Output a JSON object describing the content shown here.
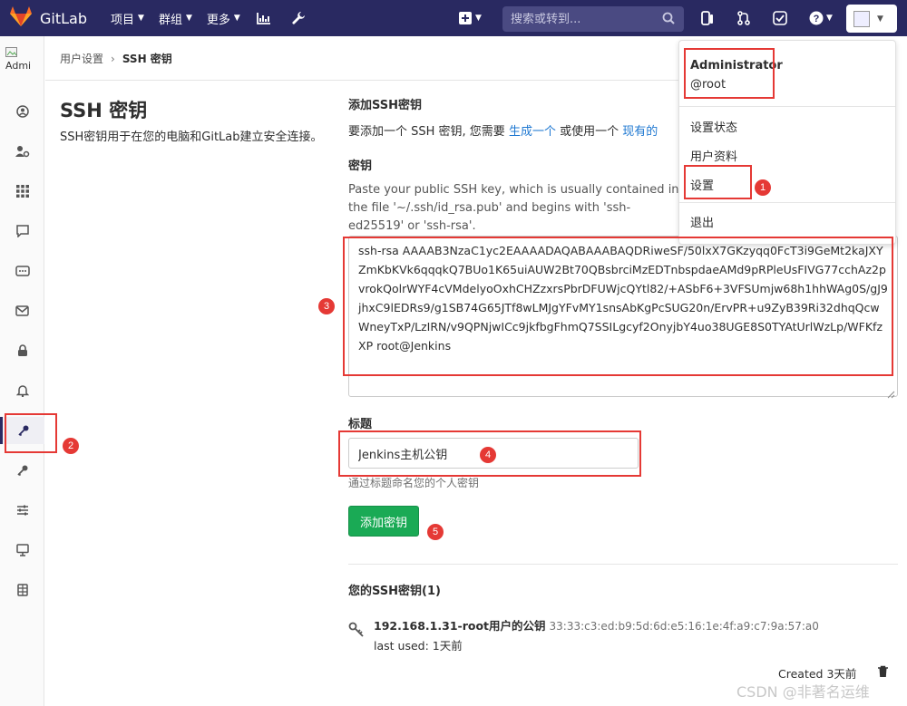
{
  "nav": {
    "brand": "GitLab",
    "menu": [
      {
        "label": "项目"
      },
      {
        "label": "群组"
      },
      {
        "label": "更多"
      }
    ],
    "search_placeholder": "搜索或转到..."
  },
  "sidebar": {
    "avatar_alt": "Admi"
  },
  "breadcrumb": {
    "parent": "用户设置",
    "current": "SSH 密钥"
  },
  "page": {
    "title": "SSH 密钥",
    "description": "SSH密钥用于在您的电脑和GitLab建立安全连接。"
  },
  "form": {
    "heading": "添加SSH密钥",
    "intro_prefix": "要添加一个 SSH 密钥, 您需要 ",
    "intro_link1": "生成一个",
    "intro_middle": " 或使用一个 ",
    "intro_link2": "现有的",
    "key_label": "密钥",
    "key_help": "Paste your public SSH key, which is usually contained in the file '~/.ssh/id_rsa.pub' and begins with 'ssh-ed25519' or 'ssh-rsa'.",
    "key_value": "ssh-rsa AAAAB3NzaC1yc2EAAAADAQABAAABAQDRiweSF/50lxX7GKzyqq0FcT3i9GeMt2kaJXYZmKbKVk6qqqkQ7BUo1K65uiAUW2Bt70QBsbrciMzEDTnbspdaeAMd9pRPleUsFIVG77cchAz2pvrokQolrWYF4cVMdelyoOxhCHZzxrsPbrDFUWjcQYtl82/+ASbF6+3VFSUmjw68h1hhWAg0S/gJ9jhxC9lEDRs9/g1SB74G65JTf8wLMJgYFvMY1snsAbKgPcSUG20n/ErvPR+u9ZyB39Ri32dhqQcwWneyTxP/LzIRN/v9QPNjwICc9jkfbgFhmQ7SSILgcyf2OnyjbY4uo38UGE8S0TYAtUrlWzLp/WFKfzXP root@Jenkins",
    "title_label": "标题",
    "title_value": "Jenkins主机公钥",
    "title_help": "通过标题命名您的个人密钥",
    "submit_label": "添加密钥"
  },
  "keys": {
    "heading": "您的SSH密钥(1)",
    "items": [
      {
        "title": "192.168.1.31-root用户的公钥",
        "fingerprint": "33:33:c3:ed:b9:5d:6d:e5:16:1e:4f:a9:c7:9a:57:a0",
        "last_used_label": "last used:",
        "last_used_value": "1天前",
        "created_label": "Created",
        "created_value": "3天前"
      }
    ]
  },
  "dropdown": {
    "name": "Administrator",
    "username": "@root",
    "items": [
      {
        "label": "设置状态"
      },
      {
        "label": "用户资料"
      },
      {
        "label": "设置"
      },
      {
        "label": "退出"
      }
    ]
  },
  "annotations": [
    "1",
    "2",
    "3",
    "4",
    "5"
  ],
  "watermark": "CSDN @非著名运维",
  "colors": {
    "nav_bg": "#292961",
    "accent_green": "#1aaa55",
    "annotation_red": "#e53935",
    "link_blue": "#1f78d1"
  }
}
